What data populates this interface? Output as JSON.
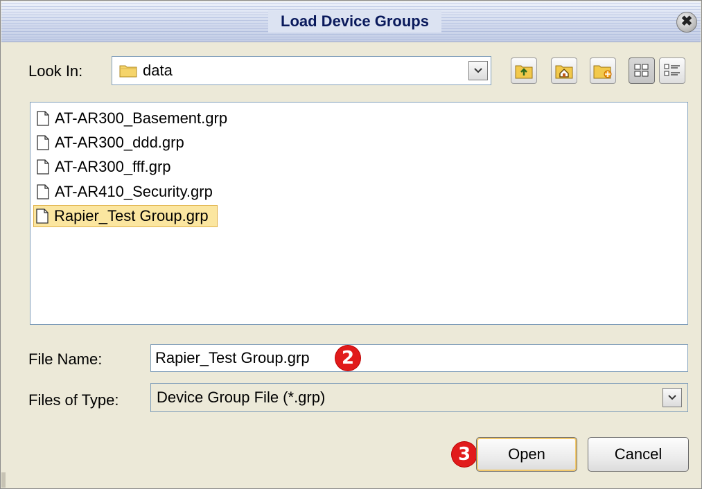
{
  "window": {
    "title": "Load Device Groups",
    "close_glyph": "✖"
  },
  "look_in": {
    "label": "Look In:",
    "value": "data",
    "icon": "folder-icon",
    "toolbar": [
      {
        "name": "up-one-level-icon"
      },
      {
        "name": "home-icon"
      },
      {
        "name": "new-folder-icon"
      },
      {
        "name": "list-view-icon"
      },
      {
        "name": "details-view-icon"
      }
    ]
  },
  "files": [
    {
      "name": "AT-AR300_Basement.grp",
      "selected": false
    },
    {
      "name": "AT-AR300_ddd.grp",
      "selected": false
    },
    {
      "name": "AT-AR300_fff.grp",
      "selected": false
    },
    {
      "name": "AT-AR410_Security.grp",
      "selected": false
    },
    {
      "name": "Rapier_Test Group.grp",
      "selected": true
    }
  ],
  "file_name": {
    "label": "File Name:",
    "value": "Rapier_Test Group.grp"
  },
  "files_of_type": {
    "label": "Files of Type:",
    "value": "Device Group File (*.grp)"
  },
  "buttons": {
    "open": "Open",
    "cancel": "Cancel"
  },
  "callouts": {
    "step2": "2",
    "step3": "3"
  },
  "colors": {
    "selection": "#fbe6a0",
    "callout": "#e11b1b",
    "title_text": "#0a1a5c"
  }
}
